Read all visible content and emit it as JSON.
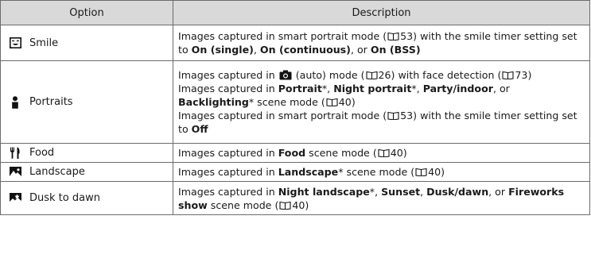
{
  "header": {
    "option": "Option",
    "description": "Description"
  },
  "ref_icon": "book-reference-icon",
  "rows": [
    {
      "icon": "smile-icon",
      "option": "Smile",
      "desc": [
        {
          "a": "Images captured in smart portrait mode (",
          "ref": "53",
          "b": ") with the smile timer setting set to "
        },
        {
          "b1": "On (single)",
          "s1": ", ",
          "b2": "On (continuous)",
          "s2": ", or ",
          "b3": "On (BSS)"
        }
      ]
    },
    {
      "icon": "portrait-icon",
      "option": "Portraits",
      "desc": {
        "p1": {
          "a": "Images captured in ",
          "icon": "camera-icon",
          "b": " (auto) mode (",
          "ref": "26",
          "c": ") with face detection (",
          "ref2": "73",
          "d": ")"
        },
        "p2": {
          "a": "Images captured in ",
          "b1": "Portrait",
          "s1": "*, ",
          "b2": "Night portrait",
          "s2": "*, ",
          "b3": "Party/indoor",
          "s3": ", or ",
          "b4": "Backlighting",
          "s4": "* scene mode (",
          "ref": "40",
          "end": ")"
        },
        "p3": {
          "a": "Images captured in smart portrait mode (",
          "ref": "53",
          "b": ") with the smile timer setting set to ",
          "b1": "Off"
        }
      }
    },
    {
      "icon": "food-icon",
      "option": "Food",
      "desc": {
        "a": "Images captured in ",
        "b1": "Food",
        "s1": " scene mode (",
        "ref": "40",
        "end": ")"
      }
    },
    {
      "icon": "landscape-icon",
      "option": "Landscape",
      "desc": {
        "a": "Images captured in ",
        "b1": "Landscape",
        "s1": "* scene mode (",
        "ref": "40",
        "end": ")"
      }
    },
    {
      "icon": "dusk-to-dawn-icon",
      "option": "Dusk to dawn",
      "desc": {
        "a": "Images captured in ",
        "b1": "Night landscape",
        "s1": "*, ",
        "b2": "Sunset",
        "s2": ", ",
        "b3": "Dusk/dawn",
        "s3": ", or ",
        "b4": "Fireworks show",
        "s4": " scene mode (",
        "ref": "40",
        "end": ")"
      }
    }
  ]
}
